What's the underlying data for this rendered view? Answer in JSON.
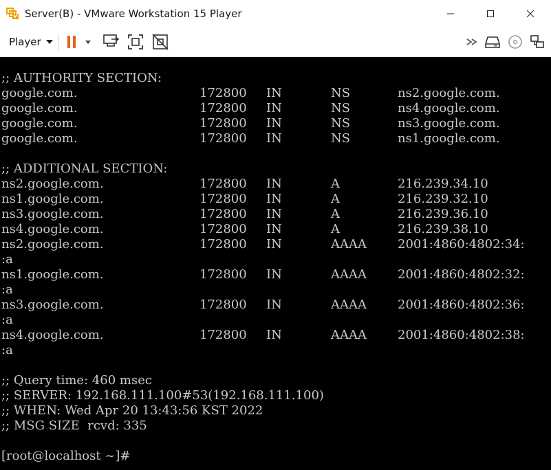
{
  "window": {
    "title": "Server(B) - VMware Workstation 15 Player"
  },
  "toolbar": {
    "player_label": "Player",
    "icons": [
      "pause-icon",
      "send-ctrl-alt-del-icon",
      "fit-guest-icon",
      "unity-icon",
      "more-icon",
      "removable-drive-icon",
      "cd-icon",
      "network-icon"
    ],
    "accent_color": "#e8611a"
  },
  "terminal": {
    "background": "#000000",
    "foreground": "#c8c8c8",
    "authority_header": ";; AUTHORITY SECTION:",
    "authority": [
      {
        "name": "google.com.",
        "ttl": "172800",
        "class": "IN",
        "type": "NS",
        "data": "ns2.google.com."
      },
      {
        "name": "google.com.",
        "ttl": "172800",
        "class": "IN",
        "type": "NS",
        "data": "ns4.google.com."
      },
      {
        "name": "google.com.",
        "ttl": "172800",
        "class": "IN",
        "type": "NS",
        "data": "ns3.google.com."
      },
      {
        "name": "google.com.",
        "ttl": "172800",
        "class": "IN",
        "type": "NS",
        "data": "ns1.google.com."
      }
    ],
    "additional_header": ";; ADDITIONAL SECTION:",
    "additional": [
      {
        "name": "ns2.google.com.",
        "ttl": "172800",
        "class": "IN",
        "type": "A",
        "data": "216.239.34.10"
      },
      {
        "name": "ns1.google.com.",
        "ttl": "172800",
        "class": "IN",
        "type": "A",
        "data": "216.239.32.10"
      },
      {
        "name": "ns3.google.com.",
        "ttl": "172800",
        "class": "IN",
        "type": "A",
        "data": "216.239.36.10"
      },
      {
        "name": "ns4.google.com.",
        "ttl": "172800",
        "class": "IN",
        "type": "A",
        "data": "216.239.38.10"
      },
      {
        "name": "ns2.google.com.",
        "ttl": "172800",
        "class": "IN",
        "type": "AAAA",
        "data": "2001:4860:4802:34:",
        "wrap": ":a"
      },
      {
        "name": "ns1.google.com.",
        "ttl": "172800",
        "class": "IN",
        "type": "AAAA",
        "data": "2001:4860:4802:32:",
        "wrap": ":a"
      },
      {
        "name": "ns3.google.com.",
        "ttl": "172800",
        "class": "IN",
        "type": "AAAA",
        "data": "2001:4860:4802:36:",
        "wrap": ":a"
      },
      {
        "name": "ns4.google.com.",
        "ttl": "172800",
        "class": "IN",
        "type": "AAAA",
        "data": "2001:4860:4802:38:",
        "wrap": ":a"
      }
    ],
    "query_time": ";; Query time: 460 msec",
    "server": ";; SERVER: 192.168.111.100#53(192.168.111.100)",
    "when": ";; WHEN: Wed Apr 20 13:43:56 KST 2022",
    "msg_size": ";; MSG SIZE  rcvd: 335",
    "prompt": "[root@localhost ~]#"
  }
}
